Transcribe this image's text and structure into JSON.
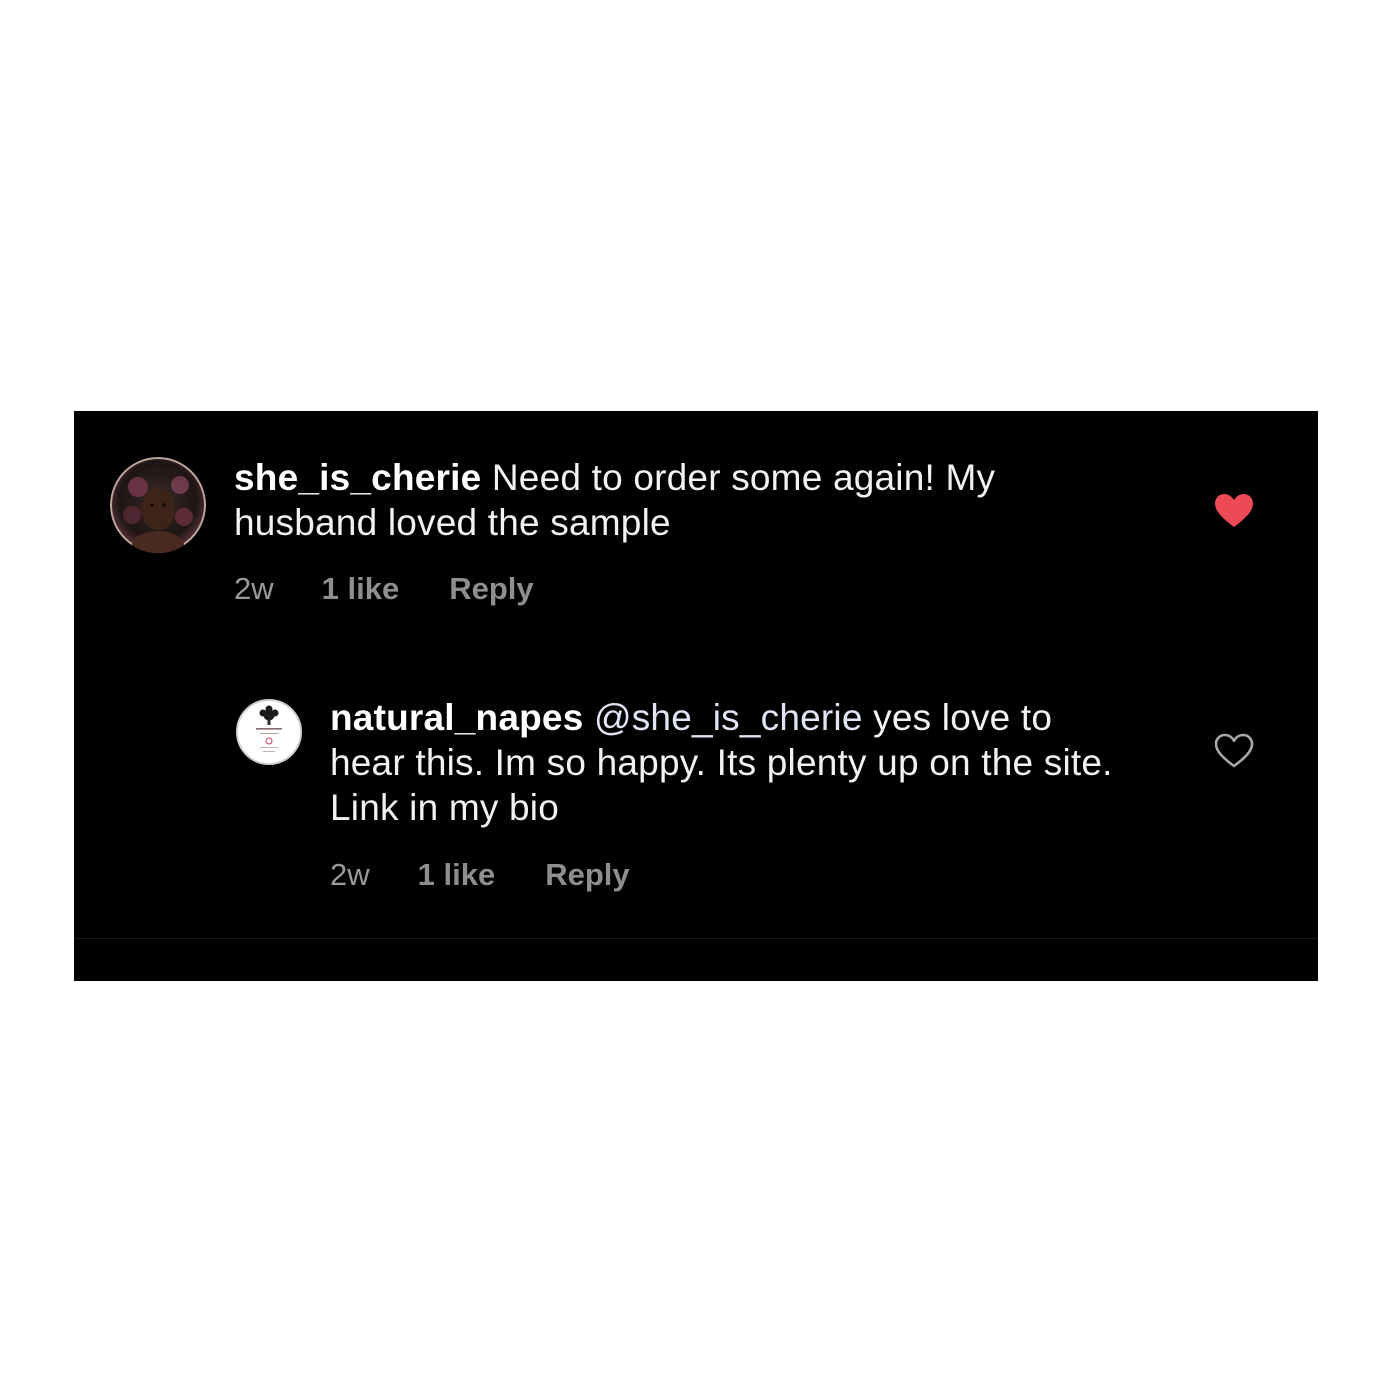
{
  "comments": [
    {
      "username": "she_is_cherie",
      "text": " Need to order some again! My husband loved the sample",
      "time": "2w",
      "likes": "1 like",
      "reply": "Reply",
      "liked": true,
      "heart_color": "#ed4956",
      "avatar": "profile-photo"
    },
    {
      "username": "natural_napes",
      "mention": "@she_is_cherie",
      "text": " yes love to hear this. Im so happy. Its plenty up on the site. Link in my bio",
      "time": "2w",
      "likes": "1 like",
      "reply": "Reply",
      "liked": false,
      "heart_color": "#a8a8a8",
      "avatar": "brand-logo"
    }
  ],
  "colors": {
    "page_background": "#ffffff",
    "panel_background": "#000000",
    "meta_text": "#8e8e8e"
  }
}
